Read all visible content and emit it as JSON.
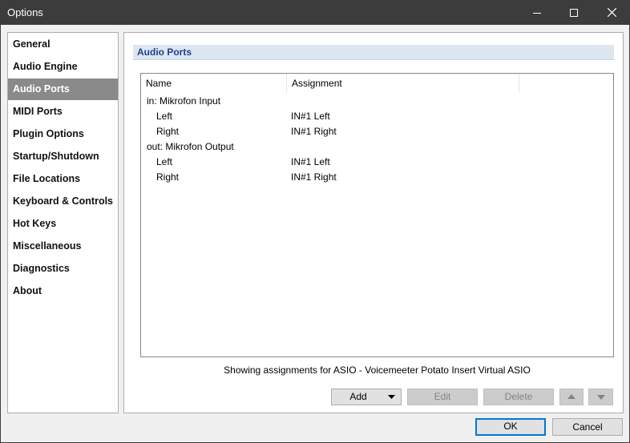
{
  "window": {
    "title": "Options"
  },
  "sidebar": {
    "items": [
      {
        "label": "General",
        "active": false
      },
      {
        "label": "Audio Engine",
        "active": false
      },
      {
        "label": "Audio Ports",
        "active": true
      },
      {
        "label": "MIDI Ports",
        "active": false
      },
      {
        "label": "Plugin Options",
        "active": false
      },
      {
        "label": "Startup/Shutdown",
        "active": false
      },
      {
        "label": "File Locations",
        "active": false
      },
      {
        "label": "Keyboard & Controls",
        "active": false
      },
      {
        "label": "Hot Keys",
        "active": false
      },
      {
        "label": "Miscellaneous",
        "active": false
      },
      {
        "label": "Diagnostics",
        "active": false
      },
      {
        "label": "About",
        "active": false
      }
    ]
  },
  "main": {
    "section_title": "Audio Ports",
    "columns": {
      "name": "Name",
      "assignment": "Assignment"
    },
    "rows": [
      {
        "name": "in: Mikrofon Input",
        "assignment": ""
      },
      {
        "name": "Left",
        "assignment": "IN#1 Left"
      },
      {
        "name": "Right",
        "assignment": "IN#1 Right"
      },
      {
        "name": "out: Mikrofon Output",
        "assignment": ""
      },
      {
        "name": "Left",
        "assignment": "IN#1 Left"
      },
      {
        "name": "Right",
        "assignment": "IN#1 Right"
      }
    ],
    "status": "Showing assignments for ASIO - Voicemeeter Potato Insert Virtual ASIO",
    "buttons": {
      "add": "Add",
      "edit": "Edit",
      "delete": "Delete"
    }
  },
  "footer": {
    "ok": "OK",
    "cancel": "Cancel"
  },
  "colors": {
    "titlebar": "#3c3c3c",
    "selected_item": "#8a8a8a",
    "section_header": "#dde6f0",
    "accent": "#0078d7"
  },
  "icons": [
    "minimize-icon",
    "maximize-icon",
    "close-icon",
    "chevron-down-icon",
    "arrow-up-icon",
    "arrow-down-icon"
  ]
}
